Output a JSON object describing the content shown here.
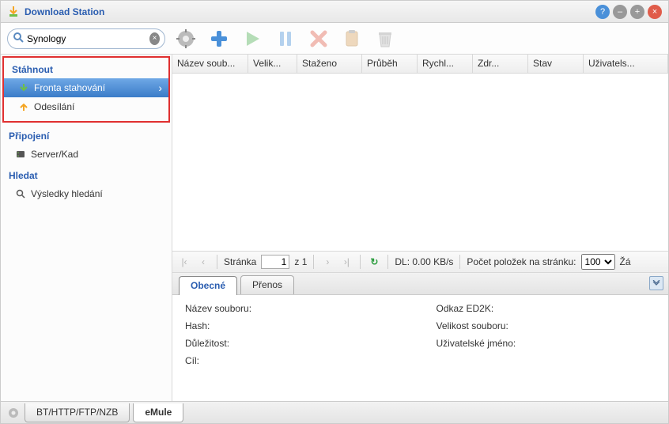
{
  "title": "Download Station",
  "search": {
    "value": "Synology"
  },
  "sidebar": {
    "download": {
      "header": "Stáhnout",
      "queue": "Fronta stahování",
      "uploading": "Odesílání"
    },
    "connection": {
      "header": "Připojení",
      "serverkad": "Server/Kad"
    },
    "search": {
      "header": "Hledat",
      "results": "Výsledky hledání"
    }
  },
  "columns": {
    "filename": "Název soub...",
    "size": "Velik...",
    "downloaded": "Staženo",
    "progress": "Průběh",
    "speed": "Rychl...",
    "source": "Zdr...",
    "status": "Stav",
    "username": "Uživatels..."
  },
  "pager": {
    "page_label": "Stránka",
    "page_value": "1",
    "page_total": "z 1",
    "dl_speed": "DL: 0.00 KB/s",
    "items_per_page_label": "Počet položek na stránku:",
    "items_per_page_value": "100",
    "no_data": "Žá"
  },
  "tabs": {
    "general": "Obecné",
    "transfer": "Přenos"
  },
  "detail": {
    "left": {
      "filename": "Název souboru:",
      "hash": "Hash:",
      "priority": "Důležitost:",
      "target": "Cíl:"
    },
    "right": {
      "ed2k": "Odkaz ED2K:",
      "filesize": "Velikost souboru:",
      "username": "Uživatelské jméno:"
    }
  },
  "bottom_tabs": {
    "bt": "BT/HTTP/FTP/NZB",
    "emule": "eMule"
  }
}
